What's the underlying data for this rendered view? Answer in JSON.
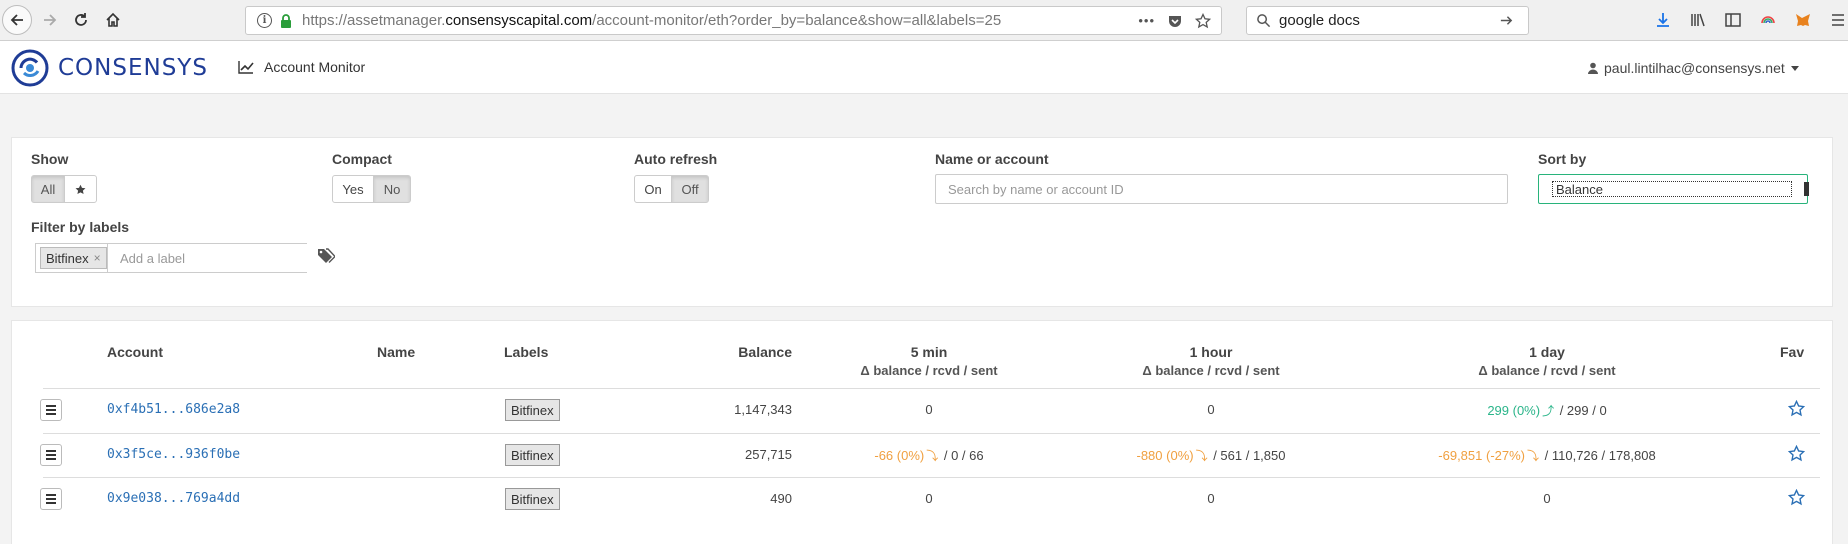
{
  "browser": {
    "url_prefix": "https://assetmanager.",
    "url_domain": "consensyscapital.com",
    "url_path": "/account-monitor/eth?order_by=balance&show=all&labels=25",
    "search_value": "google docs",
    "more_label": "•••"
  },
  "app": {
    "brand": "CONSENSYS",
    "nav_link": "Account Monitor",
    "user_email": "paul.lintilhac@consensys.net"
  },
  "filters": {
    "show_label": "Show",
    "show_all": "All",
    "compact_label": "Compact",
    "compact_yes": "Yes",
    "compact_no": "No",
    "compact_selected": "No",
    "auto_refresh_label": "Auto refresh",
    "auto_on": "On",
    "auto_off": "Off",
    "auto_selected": "Off",
    "name_label": "Name or account",
    "name_placeholder": "Search by name or account ID",
    "sort_label": "Sort by",
    "sort_value": "Balance",
    "labels_label": "Filter by labels",
    "active_label": "Bitfinex",
    "label_placeholder": "Add a label"
  },
  "table": {
    "headers": {
      "account": "Account",
      "name": "Name",
      "labels": "Labels",
      "balance": "Balance",
      "min5": "5 min",
      "hour1": "1 hour",
      "day1": "1 day",
      "sub": "Δ balance / rcvd / sent",
      "fav": "Fav"
    },
    "rows": [
      {
        "account": "0xf4b51...686e2a8",
        "label": "Bitfinex",
        "balance": "1,147,343",
        "min5": {
          "delta": "0",
          "rest": ""
        },
        "hour1": {
          "delta": "0",
          "rest": ""
        },
        "day1": {
          "delta": "299 (0%)",
          "arrow": "⤴",
          "rest": " / 299 / 0"
        }
      },
      {
        "account": "0x3f5ce...936f0be",
        "label": "Bitfinex",
        "balance": "257,715",
        "min5": {
          "delta": "-66 (0%)",
          "arrow": "⤵",
          "rest": " / 0 / 66"
        },
        "hour1": {
          "delta": "-880 (0%)",
          "arrow": "⤵",
          "rest": " / 561 / 1,850"
        },
        "day1": {
          "delta": "-69,851 (-27%)",
          "arrow": "⤵",
          "rest": " / 110,726 / 178,808"
        }
      },
      {
        "account": "0x9e038...769a4dd",
        "label": "Bitfinex",
        "balance": "490",
        "min5": {
          "delta": "0",
          "rest": ""
        },
        "hour1": {
          "delta": "0",
          "rest": ""
        },
        "day1": {
          "delta": "0",
          "rest": ""
        }
      }
    ]
  },
  "colors": {
    "brand": "#1f3c96",
    "link": "#2a6fb5",
    "negative": "#f0a040",
    "positive": "#2bb58a",
    "focus": "#28b37b"
  }
}
